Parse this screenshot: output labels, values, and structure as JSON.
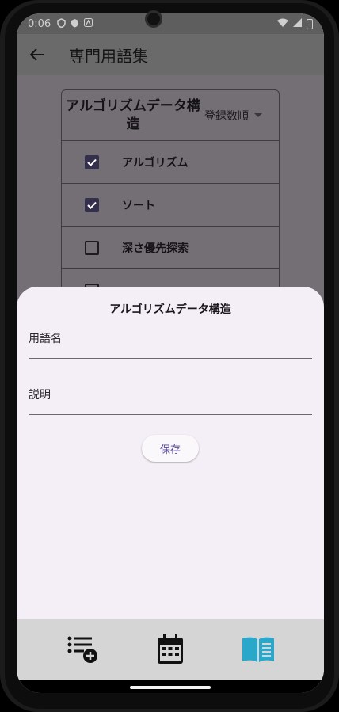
{
  "status_bar": {
    "time": "0:06"
  },
  "app_bar": {
    "title": "専門用語集"
  },
  "table": {
    "header_title": "アルゴリズムデータ構造",
    "sort_label": "登録数順",
    "rows": [
      {
        "term": "アルゴリズム",
        "checked": true
      },
      {
        "term": "ソート",
        "checked": true
      },
      {
        "term": "深さ優先探索",
        "checked": false
      }
    ]
  },
  "sheet": {
    "title": "アルゴリズムデータ構造",
    "term_label": "用語名",
    "term_value": "",
    "desc_label": "説明",
    "desc_value": "",
    "save_label": "保存"
  },
  "bottom_nav": {
    "items": [
      {
        "icon": "list-add-icon",
        "selected": false
      },
      {
        "icon": "calendar-icon",
        "selected": false
      },
      {
        "icon": "book-icon",
        "selected": true
      }
    ],
    "selected_color": "#2ba7c9"
  }
}
